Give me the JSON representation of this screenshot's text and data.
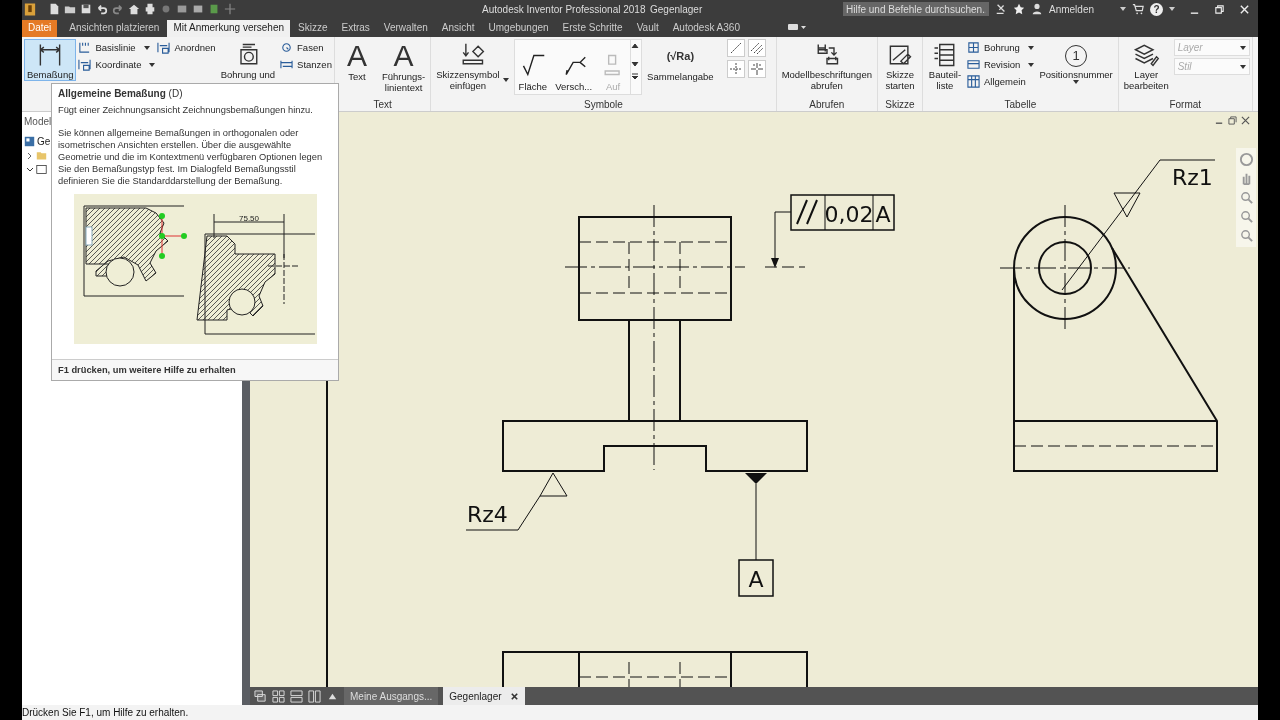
{
  "title_bar": {
    "title": "Autodesk Inventor Professional 2018",
    "document": "Gegenlager",
    "search_placeholder": "Hilfe und Befehle durchsuchen..",
    "sign_in": "Anmelden",
    "help_glyph": "?"
  },
  "tabs": [
    {
      "label": "Datei",
      "kind": "file",
      "selected": false
    },
    {
      "label": "Ansichten platzieren",
      "kind": "tab",
      "selected": false
    },
    {
      "label": "Mit Anmerkung versehen",
      "kind": "tab",
      "selected": true
    },
    {
      "label": "Skizze",
      "kind": "tab",
      "selected": false
    },
    {
      "label": "Extras",
      "kind": "tab",
      "selected": false
    },
    {
      "label": "Verwalten",
      "kind": "tab",
      "selected": false
    },
    {
      "label": "Ansicht",
      "kind": "tab",
      "selected": false
    },
    {
      "label": "Umgebungen",
      "kind": "tab",
      "selected": false
    },
    {
      "label": "Erste Schritte",
      "kind": "tab",
      "selected": false
    },
    {
      "label": "Vault",
      "kind": "tab",
      "selected": false
    },
    {
      "label": "Autodesk A360",
      "kind": "tab",
      "selected": false
    }
  ],
  "ribbon": {
    "panels": [
      {
        "items": [
          {
            "kind": "large",
            "label": "Bemaßung",
            "highlighted": true
          },
          {
            "kind": "stack",
            "buttons": [
              {
                "label": "Basislinie",
                "dropdown": true
              },
              {
                "label": "Koordinate",
                "dropdown": true
              }
            ]
          },
          {
            "kind": "stack",
            "buttons": [
              {
                "label": "Anordnen",
                "dropdown": false
              }
            ]
          },
          {
            "kind": "large",
            "label": "Bohrung und",
            "highlighted": false
          },
          {
            "kind": "stack",
            "buttons": [
              {
                "label": "Fasen",
                "dropdown": false
              },
              {
                "label": "Stanzen",
                "dropdown": false
              }
            ]
          }
        ]
      },
      {
        "label": "Text",
        "items": [
          {
            "kind": "large",
            "label": "Text",
            "glyph": "A",
            "highlighted": false
          },
          {
            "kind": "large",
            "label": "Führungs-\nlinientext",
            "glyph": "A",
            "highlighted": false
          }
        ]
      },
      {
        "label": "Symbole",
        "items": [
          {
            "kind": "large",
            "label": "Skizzensymbol\neinfügen",
            "dropdown": true,
            "highlighted": false
          },
          {
            "kind": "gallery",
            "buttons": [
              {
                "label": "Fläche",
                "disabled": false
              },
              {
                "label": "Versch...",
                "disabled": false
              },
              {
                "label": "Auf",
                "disabled": true
              }
            ]
          },
          {
            "kind": "large",
            "label": "Sammelangabe",
            "glyph": "(√Ra)",
            "highlighted": false
          },
          {
            "kind": "icon_grid"
          }
        ]
      },
      {
        "label": "Abrufen",
        "items": [
          {
            "kind": "large",
            "label": "Modellbeschriftungen\nabrufen",
            "highlighted": false
          }
        ]
      },
      {
        "label": "Skizze",
        "items": [
          {
            "kind": "large",
            "label": "Skizze\nstarten",
            "highlighted": false
          }
        ]
      },
      {
        "label": "Tabelle",
        "items": [
          {
            "kind": "large",
            "label": "Bauteil-\nliste",
            "highlighted": false
          },
          {
            "kind": "stack",
            "buttons": [
              {
                "label": "Bohrung",
                "dropdown": true
              },
              {
                "label": "Revision",
                "dropdown": true
              },
              {
                "label": "Allgemein",
                "dropdown": false
              }
            ]
          },
          {
            "kind": "large",
            "label": "Positionsnummer",
            "glyph": "1",
            "dropdown": true,
            "highlighted": false
          }
        ]
      },
      {
        "label": "Format",
        "items": [
          {
            "kind": "large",
            "label": "Layer\nbearbeiten",
            "highlighted": false
          },
          {
            "kind": "combos",
            "fields": [
              {
                "placeholder": "Layer"
              },
              {
                "placeholder": "Stil"
              }
            ]
          }
        ]
      }
    ]
  },
  "tooltip": {
    "title": "Allgemeine Bemaßung",
    "shortcut": "(D)",
    "summary": "Fügt einer Zeichnungsansicht Zeichnungsbemaßungen hinzu.",
    "body": "Sie können allgemeine Bemaßungen in orthogonalen oder isometrischen Ansichten erstellen. Über die ausgewählte Geometrie und die im Kontextmenü verfügbaren Optionen legen Sie den Bemaßungstyp fest. Im Dialogfeld Bemaßungsstil definieren Sie die Standarddarstellung der Bemaßung.",
    "illustration_dimension": "75.50",
    "footer": "F1 drücken, um weitere Hilfe zu erhalten"
  },
  "browser": {
    "heading": "Model",
    "root": "Ge"
  },
  "drawing": {
    "tolerance_value": "0,02",
    "tolerance_datum": "A",
    "datum_label": "A",
    "roughness_side": "Rz1",
    "roughness_front": "Rz4"
  },
  "document_tabs": [
    {
      "label": "Meine Ausgangs...",
      "selected": false,
      "closable": false
    },
    {
      "label": "Gegenlager",
      "selected": true,
      "closable": true
    }
  ],
  "status_bar": "Drücken Sie F1, um Hilfe zu erhalten."
}
